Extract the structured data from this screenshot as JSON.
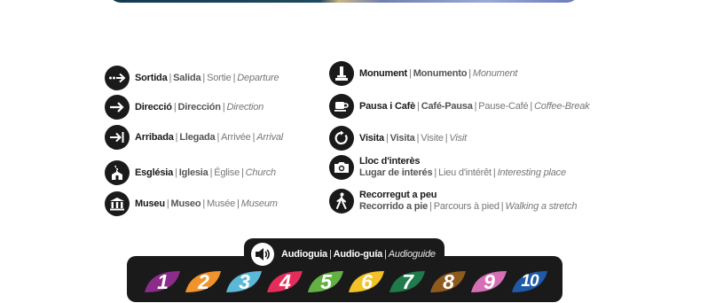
{
  "legend": {
    "left": [
      {
        "icon": "exit-arrow-icon",
        "b": "Sortida",
        "e": "Salida",
        "f": "Sortie",
        "en": "Departure"
      },
      {
        "icon": "direction-arrow-icon",
        "b": "Direcció",
        "e": "Dirección",
        "f": "",
        "en": "Direction"
      },
      {
        "icon": "arrival-arrow-icon",
        "b": "Arribada",
        "e": "Llegada",
        "f": "Arrivée",
        "en": "Arrival"
      },
      {
        "icon": "church-icon",
        "b": "Església",
        "e": "Iglesia",
        "f": "Église",
        "en": "Church"
      },
      {
        "icon": "museum-icon",
        "b": "Museu",
        "e": "Museo",
        "f": "Musée",
        "en": "Museum"
      }
    ],
    "right": [
      {
        "icon": "monument-icon",
        "b": "Monument",
        "e": "Monumento",
        "f": "",
        "en": "Monument"
      },
      {
        "icon": "coffee-cup-icon",
        "b": "Pausa i Cafè",
        "e": "Café-Pausa",
        "f": "Pause-Café",
        "en": "Coffee-Break"
      },
      {
        "icon": "visit-circular-arrow-icon",
        "b": "Visita",
        "e": "Visita",
        "f": "Visite",
        "en": "Visit"
      },
      {
        "icon": "camera-icon",
        "b": "Lloc d'interès",
        "e": "Lugar de interés",
        "f": "Lieu d'intérêt",
        "en": "Interesting place"
      },
      {
        "icon": "walking-person-icon",
        "b": "Recorregut a peu",
        "e": "Recorrido a pie",
        "f": "Parcours à pied",
        "en": "Walking a stretch"
      }
    ]
  },
  "audio": {
    "icon": "speaker-icon",
    "b": "Audioguia",
    "e": "Audio-guía",
    "en": "Audioguide",
    "tracks": [
      {
        "n": "1",
        "color": "#8b2c8a"
      },
      {
        "n": "2",
        "color": "#f0932b"
      },
      {
        "n": "3",
        "color": "#5bb8d6"
      },
      {
        "n": "4",
        "color": "#e42d5b"
      },
      {
        "n": "5",
        "color": "#63b045"
      },
      {
        "n": "6",
        "color": "#f3c228"
      },
      {
        "n": "7",
        "color": "#1f7a4c"
      },
      {
        "n": "8",
        "color": "#8f5a1e"
      },
      {
        "n": "9",
        "color": "#d66fb5"
      },
      {
        "n": "10",
        "color": "#1e5aa8"
      }
    ]
  }
}
